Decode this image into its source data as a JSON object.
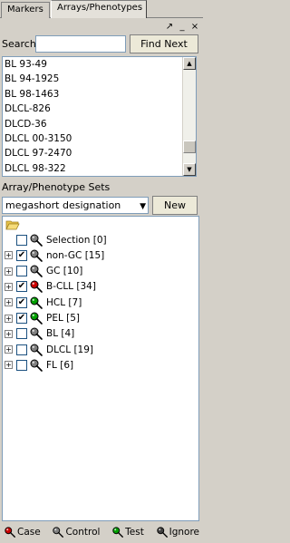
{
  "tabs": [
    {
      "label": "Markers"
    },
    {
      "label": "Arrays/Phenotypes"
    }
  ],
  "window_buttons": {
    "pin": "↗",
    "minimize": "_",
    "close": "×"
  },
  "search": {
    "label": "Search:",
    "value": "",
    "button": "Find Next"
  },
  "array_list": {
    "items": [
      "BL 93-49",
      "BL 94-1925",
      "BL 98-1463",
      "DLCL-826",
      "DLCD-36",
      "DLCL 00-3150",
      "DLCL 97-2470",
      "DLCL 98-322"
    ]
  },
  "sets": {
    "title": "Array/Phenotype Sets",
    "selected": "megashort designation",
    "new_button": "New"
  },
  "tree": [
    {
      "label": "Selection [0]",
      "expandable": false,
      "checked": false,
      "pin_color": "#808080"
    },
    {
      "label": "non-GC [15]",
      "expandable": true,
      "checked": true,
      "pin_color": "#808080"
    },
    {
      "label": "GC [10]",
      "expandable": true,
      "checked": false,
      "pin_color": "#808080"
    },
    {
      "label": "B-CLL [34]",
      "expandable": true,
      "checked": true,
      "pin_color": "#cc0000"
    },
    {
      "label": "HCL [7]",
      "expandable": true,
      "checked": true,
      "pin_color": "#00a000"
    },
    {
      "label": "PEL [5]",
      "expandable": true,
      "checked": true,
      "pin_color": "#00a000"
    },
    {
      "label": "BL [4]",
      "expandable": true,
      "checked": false,
      "pin_color": "#808080"
    },
    {
      "label": "DLCL [19]",
      "expandable": true,
      "checked": false,
      "pin_color": "#808080"
    },
    {
      "label": "FL [6]",
      "expandable": true,
      "checked": false,
      "pin_color": "#808080"
    }
  ],
  "legend": [
    {
      "label": "Case",
      "color": "#cc0000"
    },
    {
      "label": "Control",
      "color": "#808080"
    },
    {
      "label": "Test",
      "color": "#00a000"
    },
    {
      "label": "Ignore",
      "color": "#404040"
    }
  ]
}
